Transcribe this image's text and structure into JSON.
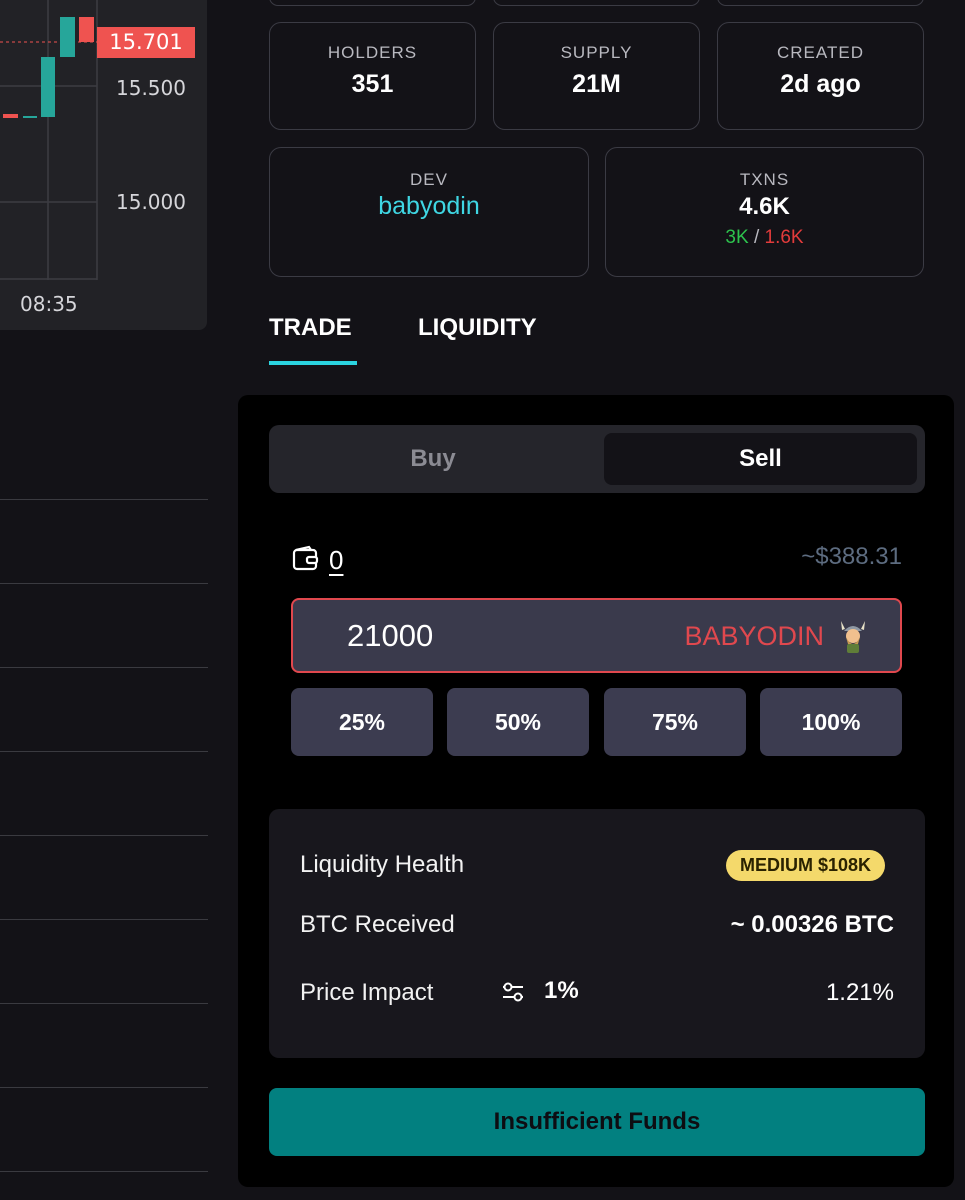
{
  "chart": {
    "price_tag": "15.701",
    "axis_labels": [
      "15.500",
      "15.000"
    ],
    "time_label": "08:35",
    "up_color": "#26a69a",
    "down_color": "#ef5350"
  },
  "stats": {
    "holders": {
      "label": "HOLDERS",
      "value": "351"
    },
    "supply": {
      "label": "SUPPLY",
      "value": "21M"
    },
    "created": {
      "label": "CREATED",
      "value": "2d ago"
    },
    "dev": {
      "label": "DEV",
      "value": "babyodin"
    },
    "txns": {
      "label": "TXNS",
      "value": "4.6K",
      "buys": "3K",
      "separator": "/",
      "sells": "1.6K"
    }
  },
  "tabs": [
    {
      "label": "TRADE",
      "active": true
    },
    {
      "label": "LIQUIDITY",
      "active": false
    }
  ],
  "trade": {
    "side_buy": "Buy",
    "side_sell": "Sell",
    "selected_side": "Sell",
    "wallet_icon": "wallet-icon",
    "wallet_balance": "0",
    "usd_value": "~$388.31",
    "amount": "21000",
    "token_symbol": "BABYODIN",
    "percent_buttons": [
      "25%",
      "50%",
      "75%",
      "100%"
    ],
    "info": {
      "liquidity_health_label": "Liquidity Health",
      "liquidity_health_badge": "MEDIUM $108K",
      "received_label": "BTC Received",
      "received_value": "~ 0.00326 BTC",
      "price_impact_label": "Price Impact",
      "slippage_icon": "sliders-icon",
      "slippage_value": "1%",
      "price_impact_value": "1.21%"
    },
    "submit_label": "Insufficient Funds",
    "accent_color": "#2bd4e0",
    "submit_color": "#028080"
  }
}
